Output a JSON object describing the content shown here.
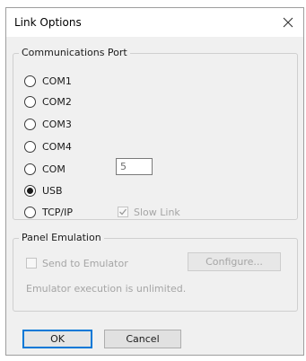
{
  "window": {
    "title": "Link Options"
  },
  "comm_port": {
    "legend": "Communications Port",
    "options": [
      "COM1",
      "COM2",
      "COM3",
      "COM4",
      "COM",
      "USB",
      "TCP/IP"
    ],
    "selected": "USB",
    "port_value": "5",
    "slow_link_label": "Slow Link"
  },
  "panel_emulation": {
    "legend": "Panel Emulation",
    "send_label": "Send to Emulator",
    "configure_label": "Configure...",
    "status_text": "Emulator execution is unlimited."
  },
  "buttons": {
    "ok": "OK",
    "cancel": "Cancel"
  },
  "icons": {
    "close": "close-icon",
    "checkmark": "checkmark-icon"
  },
  "colors": {
    "ok_border": "#0078d7",
    "disabled_text": "#a5a5a5"
  }
}
